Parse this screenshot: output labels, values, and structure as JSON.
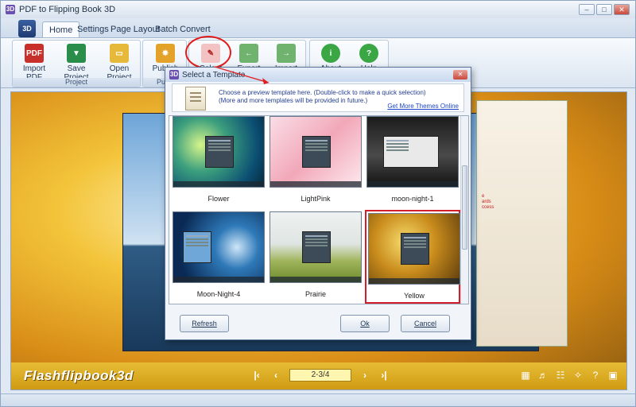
{
  "window": {
    "title": "PDF to Flipping Book 3D",
    "icon": "3D"
  },
  "tabs": [
    {
      "label": "Home",
      "active": true
    },
    {
      "label": "Settings"
    },
    {
      "label": "Page Layout"
    },
    {
      "label": "Batch Convert"
    }
  ],
  "app_button": "3D",
  "ribbon": {
    "project_group": {
      "label": "Project",
      "buttons": [
        "Import PDF",
        "Save Project",
        "Open Project"
      ]
    },
    "publish_group": {
      "label": "Publi",
      "buttons": [
        "Publish"
      ]
    },
    "template_group": {
      "buttons": [
        "Select",
        "Export",
        "Import"
      ]
    },
    "help_group": {
      "buttons": [
        "About",
        "Help"
      ]
    }
  },
  "stage": {
    "brand": "Flashflipbook3d",
    "page_indicator": "2-3/4",
    "red_text": [
      "e",
      "ards",
      "ccess"
    ]
  },
  "dialog": {
    "title": "Select a Template",
    "instruction_1": "Choose a preview template here. (Double-click to make a quick selection)",
    "instruction_2": "(More and more templates will be provided in future.)",
    "more_link": "Get More Themes Online",
    "templates": [
      {
        "name": "Flower"
      },
      {
        "name": "LightPink"
      },
      {
        "name": "moon-night-1"
      },
      {
        "name": "Moon-Night-4"
      },
      {
        "name": "Prairie"
      },
      {
        "name": "Yellow",
        "selected": true
      }
    ],
    "refresh_label": "Refresh",
    "ok_label": "Ok",
    "cancel_label": "Cancel"
  },
  "colors": {
    "highlight_red": "#e21c1c",
    "link_blue": "#1c46c8",
    "toolbar_yellow": "#d09b14"
  }
}
